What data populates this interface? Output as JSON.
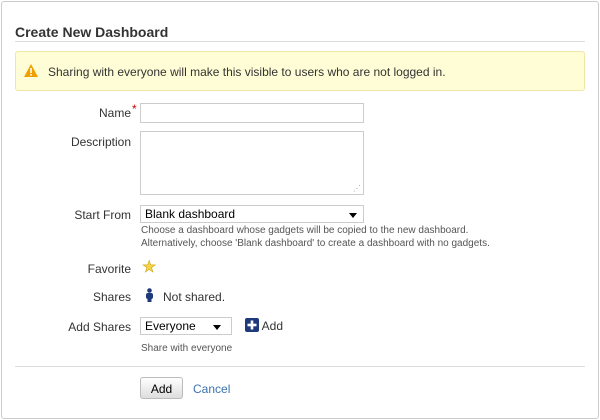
{
  "title": "Create New Dashboard",
  "warning": "Sharing with everyone will make this visible to users who are not logged in.",
  "form": {
    "name_label": "Name",
    "required_mark": "*",
    "name_value": "",
    "description_label": "Description",
    "description_value": "",
    "start_from_label": "Start From",
    "start_from_value": "Blank dashboard",
    "start_from_help1": "Choose a dashboard whose gadgets will be copied to the new dashboard.",
    "start_from_help2": "Alternatively, choose 'Blank dashboard' to create a dashboard with no gadgets.",
    "favorite_label": "Favorite",
    "shares_label": "Shares",
    "shares_value": "Not shared.",
    "add_shares_label": "Add Shares",
    "add_shares_value": "Everyone",
    "add_link": "Add",
    "add_shares_help": "Share with everyone"
  },
  "actions": {
    "submit": "Add",
    "cancel": "Cancel"
  },
  "colors": {
    "accent": "#3b73af",
    "warning_bg": "#fffdd6",
    "required": "#c00"
  }
}
